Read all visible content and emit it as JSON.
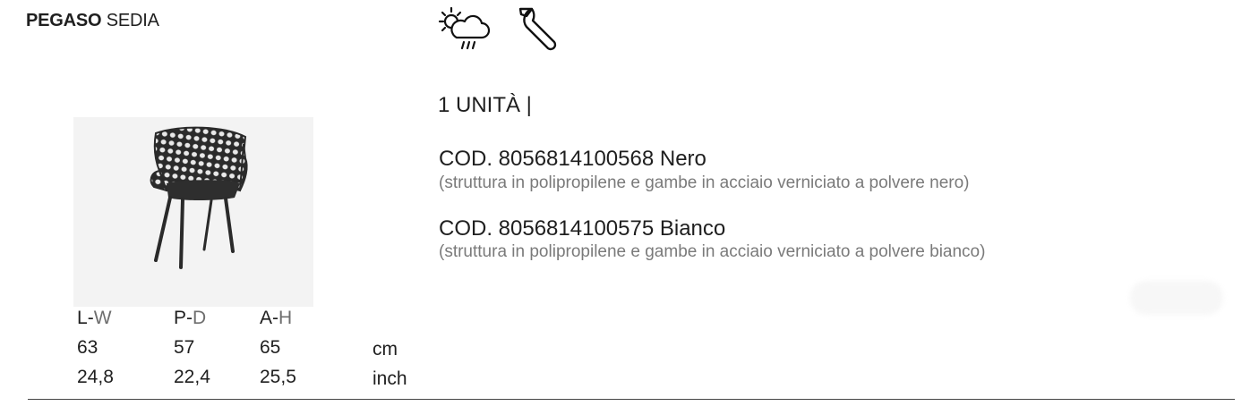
{
  "product": {
    "name_bold": "PEGASO",
    "name_light": "SEDIA"
  },
  "icons": [
    "weather-sun-cloud-rain-icon",
    "wrench-icon"
  ],
  "package": {
    "units": "1 UNITÀ |"
  },
  "variants": [
    {
      "code": "COD. 8056814100568 Nero",
      "description": "(struttura in polipropilene e gambe in acciaio verniciato a polvere nero)"
    },
    {
      "code": "COD. 8056814100575 Bianco",
      "description": "(struttura in polipropilene e gambe in acciaio verniciato a polvere bianco)"
    }
  ],
  "dimensions": {
    "headers": [
      {
        "main": "L",
        "sep": "-",
        "alt": "W"
      },
      {
        "main": "P",
        "sep": "-",
        "alt": "D"
      },
      {
        "main": "A",
        "sep": "-",
        "alt": "H"
      }
    ],
    "rows": [
      {
        "values": [
          "63",
          "57",
          "65"
        ],
        "unit": "cm"
      },
      {
        "values": [
          "24,8",
          "22,4",
          "25,5"
        ],
        "unit": "inch"
      }
    ]
  }
}
